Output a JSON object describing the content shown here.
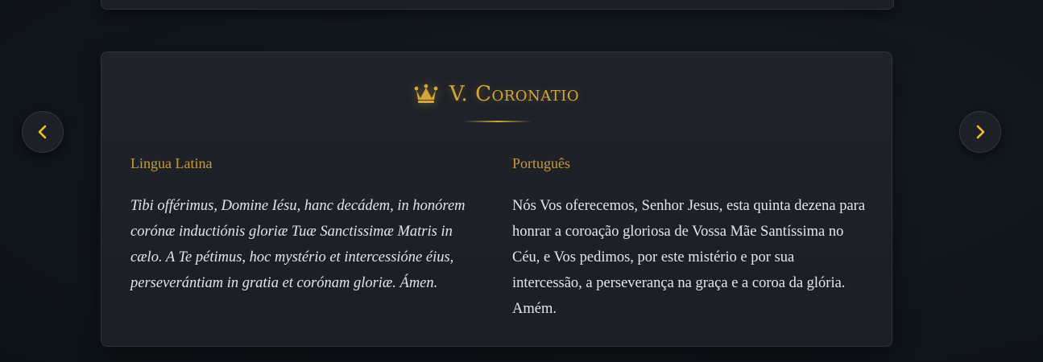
{
  "mystery": {
    "title": "V. Coronatio",
    "icon": "crown-icon",
    "accent_color": "#d4a63a"
  },
  "columns": {
    "latin": {
      "heading": "Lingua Latina",
      "text": "Tibi offérimus, Domine Iésu, hanc decádem, in honórem corónæ inductiónis gloriæ Tuæ Sanctissimæ Matris in cælo. A Te pétimus, hoc mystério et intercessióne éius, perseverántiam in gratia et corónam gloriæ. Ámen."
    },
    "portuguese": {
      "heading": "Português",
      "text": "Nós Vos oferecemos, Senhor Jesus, esta quinta dezena para honrar a coroação gloriosa de Vossa Mãe Santíssima no Céu, e Vos pedimos, por este mistério e por sua intercessão, a perseverança na graça e a coroa da glória. Amém."
    }
  },
  "navigation": {
    "prev_icon": "chevron-left-icon",
    "next_icon": "chevron-right-icon",
    "icon_color": "#f2c224"
  }
}
